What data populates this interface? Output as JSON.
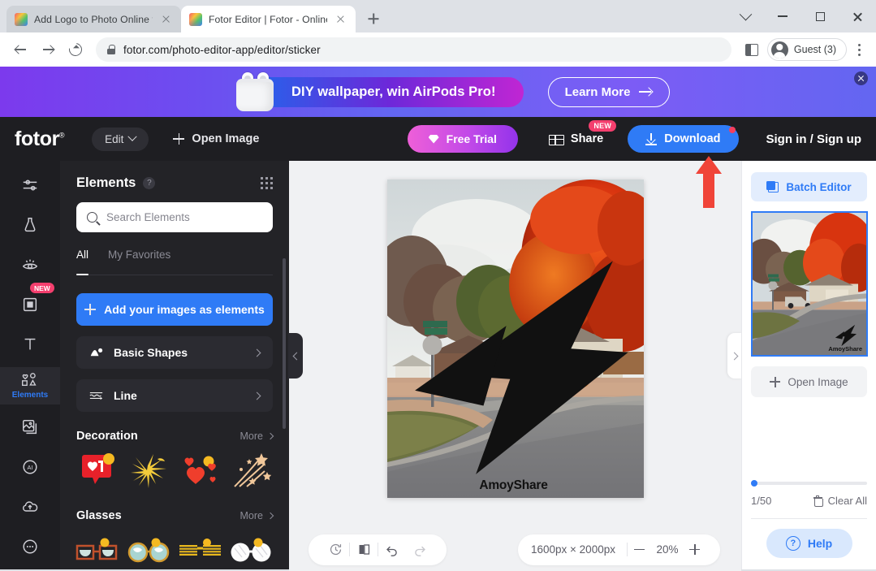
{
  "browser": {
    "tabs": [
      {
        "title": "Add Logo to Photo Online for",
        "active": false
      },
      {
        "title": "Fotor Editor  |  Fotor - Online",
        "active": true
      }
    ],
    "url": "fotor.com/photo-editor-app/editor/sticker",
    "profile_label": "Guest (3)",
    "icons": {
      "back": "back-arrow-icon",
      "forward": "forward-arrow-icon",
      "reload": "reload-icon",
      "lock": "lock-icon",
      "new_tab": "new-tab-plus-icon",
      "side_panel": "side-panel-icon",
      "menu": "kebab-menu-icon",
      "minimize": "minimize-icon",
      "maximize": "maximize-icon",
      "close": "window-close-icon",
      "tab_search": "tab-search-chevron-icon"
    }
  },
  "promo": {
    "headline": "DIY wallpaper, win AirPods Pro!",
    "cta": "Learn More",
    "close_label": "×"
  },
  "app_header": {
    "logo": "fotor",
    "logo_sup": "®",
    "edit_label": "Edit",
    "open_image_label": "Open Image",
    "free_trial_label": "Free Trial",
    "share_label": "Share",
    "share_badge": "NEW",
    "download_label": "Download",
    "signin_label": "Sign in / Sign up",
    "colors": {
      "download_blue": "#2f7bf6",
      "badge_pink": "#f43f6e",
      "header_bg": "#1e1e22"
    }
  },
  "rail": {
    "items": [
      {
        "label": "",
        "icon": "adjust-sliders-icon",
        "active": false,
        "badge": ""
      },
      {
        "label": "",
        "icon": "retouch-body-icon",
        "active": false,
        "badge": ""
      },
      {
        "label": "",
        "icon": "eye-beauty-icon",
        "active": false,
        "badge": ""
      },
      {
        "label": "",
        "icon": "frame-square-icon",
        "active": false,
        "badge": "NEW"
      },
      {
        "label": "",
        "icon": "text-t-icon",
        "active": false,
        "badge": ""
      },
      {
        "label": "Elements",
        "icon": "elements-shapes-icon",
        "active": true,
        "badge": ""
      },
      {
        "label": "",
        "icon": "photos-stack-icon",
        "active": false,
        "badge": ""
      },
      {
        "label": "",
        "icon": "ai-circle-icon",
        "active": false,
        "badge": ""
      },
      {
        "label": "",
        "icon": "cloud-upload-icon",
        "active": false,
        "badge": ""
      },
      {
        "label": "",
        "icon": "more-dots-circle-icon",
        "active": false,
        "badge": ""
      }
    ]
  },
  "elements_panel": {
    "title": "Elements",
    "help_glyph": "?",
    "search_placeholder": "Search Elements",
    "search_value": "",
    "tabs": [
      {
        "label": "All",
        "active": true
      },
      {
        "label": "My Favorites",
        "active": false
      }
    ],
    "add_images_label": "Add your images as elements",
    "categories": [
      {
        "label": "Basic Shapes",
        "icon": "basic-shapes-icon"
      },
      {
        "label": "Line",
        "icon": "line-icon"
      }
    ],
    "sections": [
      {
        "title": "Decoration",
        "more_label": "More",
        "thumbs": [
          "like-notification-badge",
          "yellow-sparkle-burst",
          "red-hearts",
          "star-confetti"
        ]
      },
      {
        "title": "Glasses",
        "more_label": "More",
        "thumbs": [
          "square-retro-glasses",
          "round-teal-glasses",
          "yellow-shutter-shades",
          "white-round-glasses"
        ]
      }
    ]
  },
  "canvas": {
    "image_alt": "Autumn neighborhood street with red maple trees, house, garage and pickup truck",
    "watermark_text": "AmoyShare",
    "collapse_left_icon": "chevron-left-icon",
    "collapse_right_icon": "chevron-right-icon",
    "annotation": {
      "type": "red-up-arrow",
      "color": "#f04438",
      "points_to": "Download"
    }
  },
  "right_panel": {
    "batch_editor_label": "Batch Editor",
    "open_image_label": "Open Image",
    "count_label": "1/50",
    "clear_all_label": "Clear All",
    "help_label": "Help",
    "thumbnail_watermark": "AmoyShare"
  },
  "bottom_toolbar": {
    "tools": [
      {
        "icon": "history-clock-icon",
        "name": "history"
      },
      {
        "icon": "compare-split-icon",
        "name": "compare"
      },
      {
        "icon": "undo-arrow-icon",
        "name": "undo"
      },
      {
        "icon": "redo-arrow-icon",
        "name": "redo"
      }
    ],
    "dimensions": "1600px × 2000px",
    "zoom_out_label": "−",
    "zoom_value": "20%",
    "zoom_in_label": "+"
  }
}
